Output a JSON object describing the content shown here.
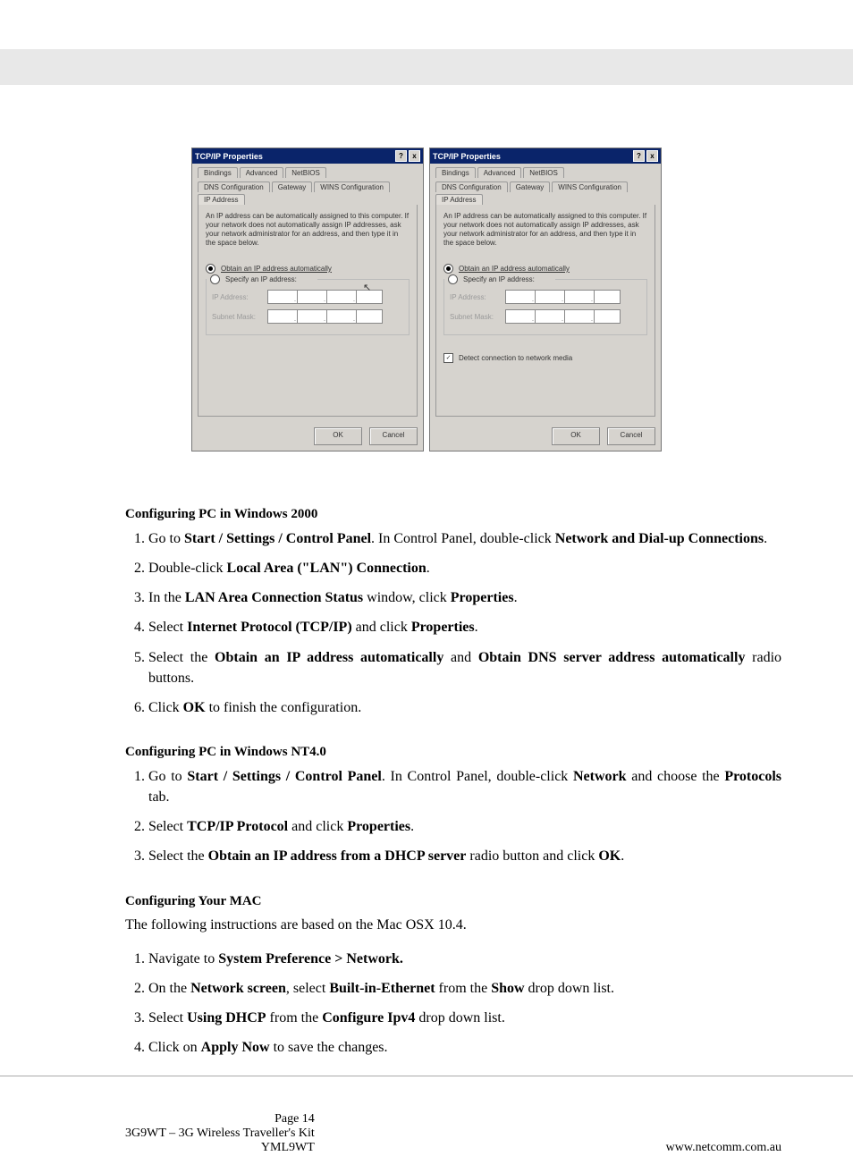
{
  "dialog": {
    "title": "TCP/IP Properties",
    "help": "?",
    "close": "x",
    "tabs_row1": [
      {
        "label": "Bindings"
      },
      {
        "label": "Advanced"
      },
      {
        "label": "NetBIOS"
      }
    ],
    "tabs_row2": [
      {
        "label": "DNS Configuration"
      },
      {
        "label": "Gateway"
      },
      {
        "label": "WINS Configuration"
      },
      {
        "label": "IP Address"
      }
    ],
    "description": "An IP address can be automatically assigned to this computer. If your network does not automatically assign IP addresses, ask your network administrator for an address, and then type it in the space below.",
    "radio_auto": "Obtain an IP address automatically",
    "radio_specify": "Specify an IP address:",
    "field_ip": "IP Address:",
    "field_mask": "Subnet Mask:",
    "detect": "Detect connection to network media",
    "ok": "OK",
    "cancel": "Cancel"
  },
  "txt": {
    "c1": "Configuring PC in Windows 2000",
    "c1s1": "Go to Start / Settings / Control Panel. In Control Panel, double-click Network and Dial-up Connections.",
    "c1s2": "Double-click Local Area (\"LAN\") Connection.",
    "c1s3": "In the LAN Area Connection Status window, click Properties.",
    "c1s4": "Select Internet Protocol (TCP/IP) and click Properties.",
    "c1s5": "Select the Obtain an IP address automatically and Obtain DNS server address automatically radio buttons.",
    "c1s6": "Click OK to finish the configuration.",
    "c2": "Configuring PC in Windows NT4.0",
    "c2s1": "Go to Start / Settings / Control Panel. In Control Panel, double-click Network and choose the Protocols tab.",
    "c2s2": "Select TCP/IP Protocol and click Properties.",
    "c2s3": "Select the Obtain an IP address from a DHCP server radio button and click OK.",
    "c3": "Configuring Your MAC",
    "c3s1": "The following instructions are based on the Mac OSX 10.4.",
    "c3s2": "Navigate to System Preference > Network.",
    "c3s3": "On the Network screen, select Built-in-Ethernet from the Show drop down list.",
    "c3s4": "Select Using DHCP from the Configure Ipv4 drop down list.",
    "c3s5": "Click on Apply Now to save the changes.",
    "footer_left": "Page 14\n3G9WT – 3G Wireless Traveller's Kit\nYML9WT",
    "footer_right": "www.netcomm.com.au"
  }
}
